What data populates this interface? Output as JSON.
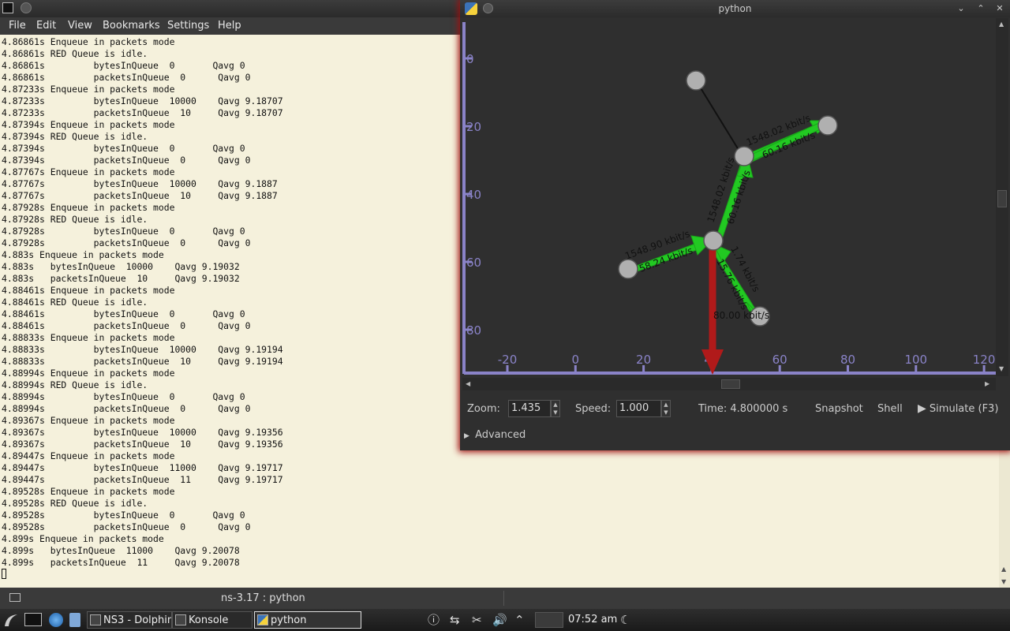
{
  "konsole": {
    "menu": [
      "File",
      "Edit",
      "View",
      "Bookmarks",
      "Settings",
      "Help"
    ],
    "terminal_lines": [
      "4.86861s Enqueue in packets mode",
      "4.86861s RED Queue is idle.",
      "4.86861s         bytesInQueue  0       Qavg 0",
      "4.86861s         packetsInQueue  0      Qavg 0",
      "4.87233s Enqueue in packets mode",
      "4.87233s         bytesInQueue  10000    Qavg 9.18707",
      "4.87233s         packetsInQueue  10     Qavg 9.18707",
      "4.87394s Enqueue in packets mode",
      "4.87394s RED Queue is idle.",
      "4.87394s         bytesInQueue  0       Qavg 0",
      "4.87394s         packetsInQueue  0      Qavg 0",
      "4.87767s Enqueue in packets mode",
      "4.87767s         bytesInQueue  10000    Qavg 9.1887",
      "4.87767s         packetsInQueue  10     Qavg 9.1887",
      "4.87928s Enqueue in packets mode",
      "4.87928s RED Queue is idle.",
      "4.87928s         bytesInQueue  0       Qavg 0",
      "4.87928s         packetsInQueue  0      Qavg 0",
      "4.883s Enqueue in packets mode",
      "4.883s   bytesInQueue  10000    Qavg 9.19032",
      "4.883s   packetsInQueue  10     Qavg 9.19032",
      "4.88461s Enqueue in packets mode",
      "4.88461s RED Queue is idle.",
      "4.88461s         bytesInQueue  0       Qavg 0",
      "4.88461s         packetsInQueue  0      Qavg 0",
      "4.88833s Enqueue in packets mode",
      "4.88833s         bytesInQueue  10000    Qavg 9.19194",
      "4.88833s         packetsInQueue  10     Qavg 9.19194",
      "4.88994s Enqueue in packets mode",
      "4.88994s RED Queue is idle.",
      "4.88994s         bytesInQueue  0       Qavg 0",
      "4.88994s         packetsInQueue  0      Qavg 0",
      "4.89367s Enqueue in packets mode",
      "4.89367s         bytesInQueue  10000    Qavg 9.19356",
      "4.89367s         packetsInQueue  10     Qavg 9.19356",
      "4.89447s Enqueue in packets mode",
      "4.89447s         bytesInQueue  11000    Qavg 9.19717",
      "4.89447s         packetsInQueue  11     Qavg 9.19717",
      "4.89528s Enqueue in packets mode",
      "4.89528s RED Queue is idle.",
      "4.89528s         bytesInQueue  0       Qavg 0",
      "4.89528s         packetsInQueue  0      Qavg 0",
      "4.899s Enqueue in packets mode",
      "4.899s   bytesInQueue  11000    Qavg 9.20078",
      "4.899s   packetsInQueue  11     Qavg 9.20078"
    ],
    "status_title": "ns-3.17 : python"
  },
  "python_window": {
    "title": "python",
    "canvas": {
      "x_ticks": [
        "-20",
        "0",
        "20",
        "40",
        "60",
        "80",
        "100",
        "120"
      ],
      "y_ticks": [
        "0",
        "20",
        "40",
        "60",
        "80"
      ],
      "link_labels": [
        "1548.02 kbit/s",
        "60.16 kbit/s",
        "1548.02 kbit/s",
        "60.16 kbit/s",
        "1548.90 kbit/s",
        "58.24 kbit/s",
        "1.74 kbit/s",
        "15.76 kbit/s",
        "80.00 kbit/s"
      ]
    },
    "controls": {
      "zoom_label": "Zoom:",
      "zoom_value": "1.435",
      "speed_label": "Speed:",
      "speed_value": "1.000",
      "time_text": "Time: 4.800000 s",
      "snapshot_label": "Snapshot",
      "shell_label": "Shell",
      "simulate_label": "Simulate (F3)",
      "advanced_label": "Advanced"
    }
  },
  "taskbar": {
    "tasks": [
      "NS3 - Dolphin",
      "Konsole",
      "python"
    ],
    "clock": "07:52 am"
  },
  "colors": {
    "terminal_bg": "#f5f1dc",
    "canvas_bg": "#2f2f2f",
    "axis": "#8a83c8",
    "link_arrow": "#22c922",
    "selected_arrow": "#b01a1a",
    "node": "#b0b0b0"
  }
}
